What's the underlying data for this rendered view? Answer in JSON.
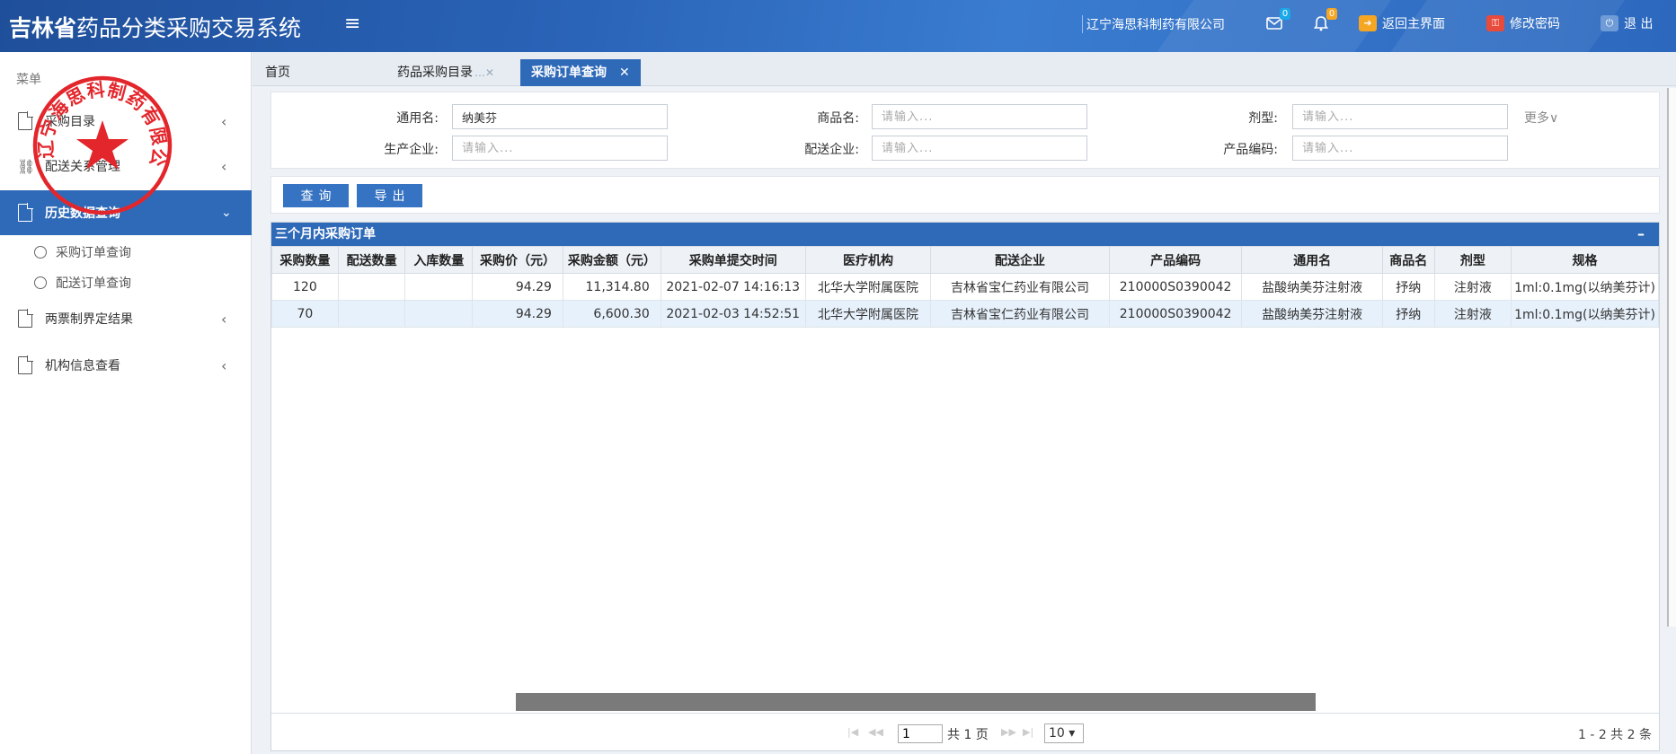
{
  "header": {
    "brand_bold": "吉林省",
    "brand_rest": "药品分类采购交易系统",
    "menu_glyph": "≡",
    "company": "辽宁海思科制药有限公司",
    "mail_badge": "0",
    "bell_badge": "0",
    "home_label": "返回主界面",
    "password_label": "修改密码",
    "logout_label": "退 出"
  },
  "sidebar": {
    "menu_label": "菜单",
    "items": [
      {
        "label": "采购目录"
      },
      {
        "label": "配送关系管理"
      },
      {
        "label": "历史数据查询"
      },
      {
        "label": "两票制界定结果"
      },
      {
        "label": "机构信息查看"
      }
    ],
    "sub_items": [
      {
        "label": "采购订单查询"
      },
      {
        "label": "配送订单查询"
      }
    ]
  },
  "stamp": {
    "text": "辽宁海思科制药有限公司"
  },
  "tabs": [
    {
      "label": "首页"
    },
    {
      "label": "药品采购目录"
    },
    {
      "label": "采购订单查询"
    }
  ],
  "filters": {
    "generic_name_label": "通用名:",
    "generic_name_value": "纳美芬",
    "trade_name_label": "商品名:",
    "dosage_form_label": "剂型:",
    "manufacturer_label": "生产企业:",
    "distributor_label": "配送企业:",
    "product_code_label": "产品编码:",
    "placeholder": "请输入...",
    "more_label": "更多∨"
  },
  "buttons": {
    "query": "查询",
    "export": "导出"
  },
  "grid": {
    "title": "三个月内采购订单",
    "collapse": "–",
    "columns": [
      "采购数量",
      "配送数量",
      "入库数量",
      "采购价（元）",
      "采购金额（元）",
      "采购单提交时间",
      "医疗机构",
      "配送企业",
      "产品编码",
      "通用名",
      "商品名",
      "剂型",
      "规格"
    ],
    "rows": [
      [
        "120",
        "",
        "",
        "94.29",
        "11,314.80",
        "2021-02-07 14:16:13",
        "北华大学附属医院",
        "吉林省宝仁药业有限公司",
        "210000S0390042",
        "盐酸纳美芬注射液",
        "抒纳",
        "注射液",
        "1ml:0.1mg(以纳美芬计)"
      ],
      [
        "70",
        "",
        "",
        "94.29",
        "6,600.30",
        "2021-02-03 14:52:51",
        "北华大学附属医院",
        "吉林省宝仁药业有限公司",
        "210000S0390042",
        "盐酸纳美芬注射液",
        "抒纳",
        "注射液",
        "1ml:0.1mg(以纳美芬计)"
      ]
    ]
  },
  "pager": {
    "page_input": "1",
    "total_pages": "共 1 页",
    "page_size": "10",
    "summary": "1 - 2   共 2 条"
  }
}
